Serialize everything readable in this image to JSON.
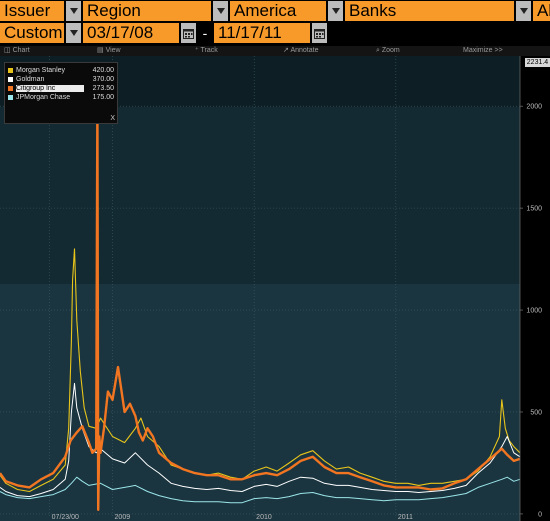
{
  "header": {
    "issuer_label": "Issuer",
    "region_label": "Region",
    "region_value": "America",
    "sector_value": "Banks",
    "scope_value": "All",
    "period_label": "Custom",
    "start_date": "03/17/08",
    "date_separator": "-",
    "end_date": "11/17/11"
  },
  "toolbar": {
    "chart": "Chart",
    "view": "View",
    "track": "Track",
    "annotate": "Annotate",
    "zoom": "Zoom",
    "maximize": "Maximize >>"
  },
  "colors": {
    "morgan_stanley": "#e8c51a",
    "goldman": "#ffffff",
    "citigroup": "#f27521",
    "jpmorgan": "#9be6ea",
    "orange_field": "#f79a2a",
    "plot_top_band": "#0d1f24",
    "plot_mid_band": "#142a32",
    "plot_bottom_band": "#1a3540"
  },
  "legend": {
    "rows": [
      {
        "name": "Morgan Stanley",
        "value": "420.00"
      },
      {
        "name": "Goldman",
        "value": "370.00"
      },
      {
        "name": "Citigroup Inc",
        "value": "273.50"
      },
      {
        "name": "JPMorgan Chase",
        "value": "175.00"
      }
    ],
    "close_symbol": "X"
  },
  "last_value_box": "2231.4",
  "chart_data": {
    "type": "line",
    "x_tick_labels": [
      "07/23/00",
      "2009",
      "2010",
      "2011"
    ],
    "x_ticks": [
      "2008-07-23",
      "2009-01-01",
      "2010-01-01",
      "2011-01-01"
    ],
    "xlim": [
      "2008-03-17",
      "2011-11-17"
    ],
    "y_tick_labels": [
      "0",
      "500",
      "1000",
      "1500",
      "2000"
    ],
    "y_ticks": [
      0,
      500,
      1000,
      1500,
      2000
    ],
    "ylim": [
      -20,
      2231.4
    ],
    "grid": true,
    "legend_position": "top-left",
    "series": [
      {
        "name": "Morgan Stanley",
        "x": [
          "2008-03-17",
          "2008-04-01",
          "2008-05-01",
          "2008-06-01",
          "2008-07-01",
          "2008-08-01",
          "2008-09-01",
          "2008-09-10",
          "2008-09-17",
          "2008-09-20",
          "2008-09-25",
          "2008-10-01",
          "2008-10-10",
          "2008-10-20",
          "2008-11-01",
          "2008-11-20",
          "2008-12-01",
          "2009-01-01",
          "2009-02-01",
          "2009-03-01",
          "2009-03-15",
          "2009-04-01",
          "2009-05-01",
          "2009-06-01",
          "2009-07-01",
          "2009-08-01",
          "2009-09-01",
          "2009-10-01",
          "2009-11-01",
          "2009-12-01",
          "2010-01-01",
          "2010-02-01",
          "2010-03-01",
          "2010-04-01",
          "2010-05-01",
          "2010-06-01",
          "2010-07-01",
          "2010-08-01",
          "2010-09-01",
          "2010-10-01",
          "2010-11-01",
          "2010-12-01",
          "2011-01-01",
          "2011-02-01",
          "2011-03-01",
          "2011-04-01",
          "2011-05-01",
          "2011-06-01",
          "2011-07-01",
          "2011-08-01",
          "2011-09-01",
          "2011-09-25",
          "2011-10-01",
          "2011-10-10",
          "2011-10-20",
          "2011-11-01",
          "2011-11-17"
        ],
        "values": [
          190,
          150,
          120,
          110,
          140,
          170,
          240,
          420,
          850,
          1150,
          1300,
          950,
          700,
          520,
          430,
          420,
          470,
          380,
          350,
          420,
          470,
          380,
          330,
          240,
          220,
          200,
          190,
          200,
          180,
          170,
          210,
          230,
          210,
          250,
          290,
          310,
          260,
          220,
          230,
          200,
          180,
          160,
          150,
          150,
          140,
          150,
          150,
          160,
          170,
          210,
          280,
          380,
          560,
          420,
          360,
          330,
          300
        ]
      },
      {
        "name": "Goldman",
        "x": [
          "2008-03-17",
          "2008-04-01",
          "2008-05-01",
          "2008-06-01",
          "2008-07-01",
          "2008-08-01",
          "2008-09-01",
          "2008-09-10",
          "2008-09-17",
          "2008-09-25",
          "2008-10-01",
          "2008-10-15",
          "2008-11-01",
          "2008-11-20",
          "2008-12-01",
          "2009-01-01",
          "2009-02-01",
          "2009-03-01",
          "2009-04-01",
          "2009-05-01",
          "2009-06-01",
          "2009-07-01",
          "2009-08-01",
          "2009-09-01",
          "2009-10-01",
          "2009-11-01",
          "2009-12-01",
          "2010-01-01",
          "2010-02-01",
          "2010-03-01",
          "2010-04-01",
          "2010-05-01",
          "2010-06-01",
          "2010-07-01",
          "2010-08-01",
          "2010-09-01",
          "2010-10-01",
          "2010-11-01",
          "2010-12-01",
          "2011-01-01",
          "2011-02-01",
          "2011-03-01",
          "2011-04-01",
          "2011-05-01",
          "2011-06-01",
          "2011-07-01",
          "2011-08-01",
          "2011-09-01",
          "2011-10-01",
          "2011-10-15",
          "2011-11-01",
          "2011-11-17"
        ],
        "values": [
          130,
          110,
          90,
          85,
          100,
          120,
          170,
          260,
          500,
          640,
          520,
          420,
          330,
          300,
          320,
          270,
          250,
          300,
          240,
          200,
          150,
          135,
          125,
          120,
          125,
          115,
          110,
          135,
          145,
          135,
          160,
          180,
          175,
          150,
          140,
          140,
          130,
          120,
          115,
          110,
          110,
          105,
          110,
          115,
          125,
          140,
          200,
          250,
          330,
          380,
          300,
          280
        ]
      },
      {
        "name": "Citigroup Inc",
        "x": [
          "2008-03-17",
          "2008-04-01",
          "2008-05-01",
          "2008-06-01",
          "2008-07-01",
          "2008-08-01",
          "2008-09-01",
          "2008-09-15",
          "2008-10-01",
          "2008-10-15",
          "2008-11-01",
          "2008-11-10",
          "2008-11-20",
          "2008-11-23",
          "2008-11-25",
          "2008-11-28",
          "2008-12-01",
          "2008-12-10",
          "2008-12-20",
          "2009-01-01",
          "2009-01-15",
          "2009-02-01",
          "2009-02-15",
          "2009-03-01",
          "2009-03-10",
          "2009-03-20",
          "2009-04-01",
          "2009-04-15",
          "2009-05-01",
          "2009-06-01",
          "2009-07-01",
          "2009-08-01",
          "2009-09-01",
          "2009-10-01",
          "2009-11-01",
          "2009-12-01",
          "2010-01-01",
          "2010-02-01",
          "2010-03-01",
          "2010-04-01",
          "2010-05-01",
          "2010-06-01",
          "2010-07-01",
          "2010-08-01",
          "2010-09-01",
          "2010-10-01",
          "2010-11-01",
          "2010-12-01",
          "2011-01-01",
          "2011-02-01",
          "2011-03-01",
          "2011-04-01",
          "2011-05-01",
          "2011-06-01",
          "2011-07-01",
          "2011-08-01",
          "2011-09-01",
          "2011-10-01",
          "2011-10-15",
          "2011-11-01",
          "2011-11-17"
        ],
        "values": [
          200,
          160,
          140,
          130,
          170,
          200,
          280,
          360,
          400,
          430,
          350,
          300,
          320,
          2050,
          20,
          380,
          300,
          420,
          600,
          560,
          720,
          500,
          540,
          480,
          400,
          360,
          420,
          380,
          300,
          250,
          220,
          200,
          190,
          190,
          170,
          170,
          190,
          200,
          190,
          220,
          260,
          280,
          230,
          200,
          200,
          180,
          160,
          140,
          130,
          130,
          130,
          120,
          125,
          150,
          170,
          220,
          270,
          320,
          290,
          260,
          270
        ]
      },
      {
        "name": "JPMorgan Chase",
        "x": [
          "2008-03-17",
          "2008-04-01",
          "2008-05-01",
          "2008-06-01",
          "2008-07-01",
          "2008-08-01",
          "2008-09-01",
          "2008-09-17",
          "2008-10-01",
          "2008-10-15",
          "2008-11-01",
          "2008-12-01",
          "2009-01-01",
          "2009-02-01",
          "2009-03-01",
          "2009-04-01",
          "2009-05-01",
          "2009-06-01",
          "2009-07-01",
          "2009-08-01",
          "2009-09-01",
          "2009-10-01",
          "2009-11-01",
          "2009-12-01",
          "2010-01-01",
          "2010-02-01",
          "2010-03-01",
          "2010-04-01",
          "2010-05-01",
          "2010-06-01",
          "2010-07-01",
          "2010-08-01",
          "2010-09-01",
          "2010-10-01",
          "2010-11-01",
          "2010-12-01",
          "2011-01-01",
          "2011-02-01",
          "2011-03-01",
          "2011-04-01",
          "2011-05-01",
          "2011-06-01",
          "2011-07-01",
          "2011-08-01",
          "2011-09-01",
          "2011-10-01",
          "2011-10-15",
          "2011-11-01",
          "2011-11-17"
        ],
        "values": [
          110,
          95,
          80,
          75,
          85,
          95,
          120,
          150,
          180,
          160,
          140,
          150,
          120,
          130,
          140,
          110,
          90,
          75,
          65,
          60,
          60,
          60,
          55,
          55,
          75,
          80,
          75,
          85,
          100,
          105,
          90,
          80,
          80,
          75,
          70,
          65,
          70,
          70,
          70,
          75,
          80,
          90,
          100,
          130,
          150,
          170,
          180,
          160,
          170
        ]
      }
    ]
  }
}
